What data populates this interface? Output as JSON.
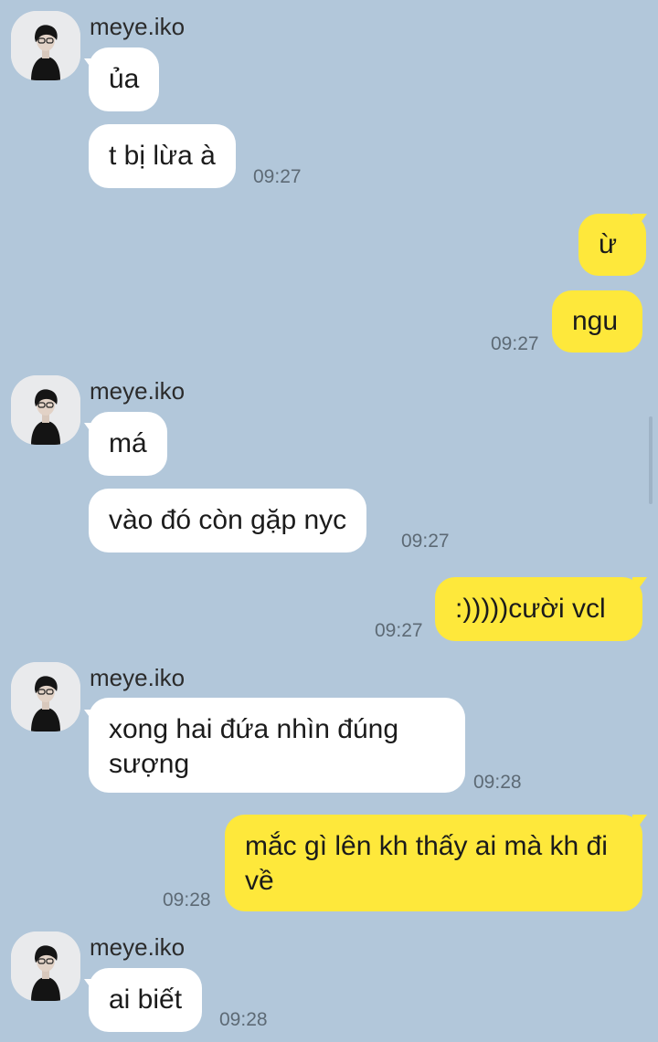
{
  "colors": {
    "background": "#b2c7da",
    "incoming_bubble": "#ffffff",
    "outgoing_bubble": "#fee83b",
    "timestamp": "#5d6a75"
  },
  "chat": {
    "groups": [
      {
        "sender": "meye.iko",
        "avatar_icon": "profile-photo-avatar",
        "messages": [
          "ủa",
          "t bị lừa à"
        ],
        "time": "09:27"
      },
      {
        "outgoing": true,
        "messages": [
          "ừ",
          "ngu"
        ],
        "time": "09:27"
      },
      {
        "sender": "meye.iko",
        "avatar_icon": "profile-photo-avatar",
        "messages": [
          "má",
          "vào đó còn gặp nyc"
        ],
        "time": "09:27"
      },
      {
        "outgoing": true,
        "messages": [
          ":)))))cười vcl"
        ],
        "time": "09:27"
      },
      {
        "sender": "meye.iko",
        "avatar_icon": "profile-photo-avatar",
        "messages": [
          "xong hai đứa nhìn đúng sượng"
        ],
        "time": "09:28"
      },
      {
        "outgoing": true,
        "messages": [
          "mắc gì lên kh thấy ai mà kh đi về"
        ],
        "time": "09:28"
      },
      {
        "sender": "meye.iko",
        "avatar_icon": "profile-photo-avatar",
        "messages": [
          "ai biết"
        ],
        "time": "09:28"
      }
    ]
  }
}
